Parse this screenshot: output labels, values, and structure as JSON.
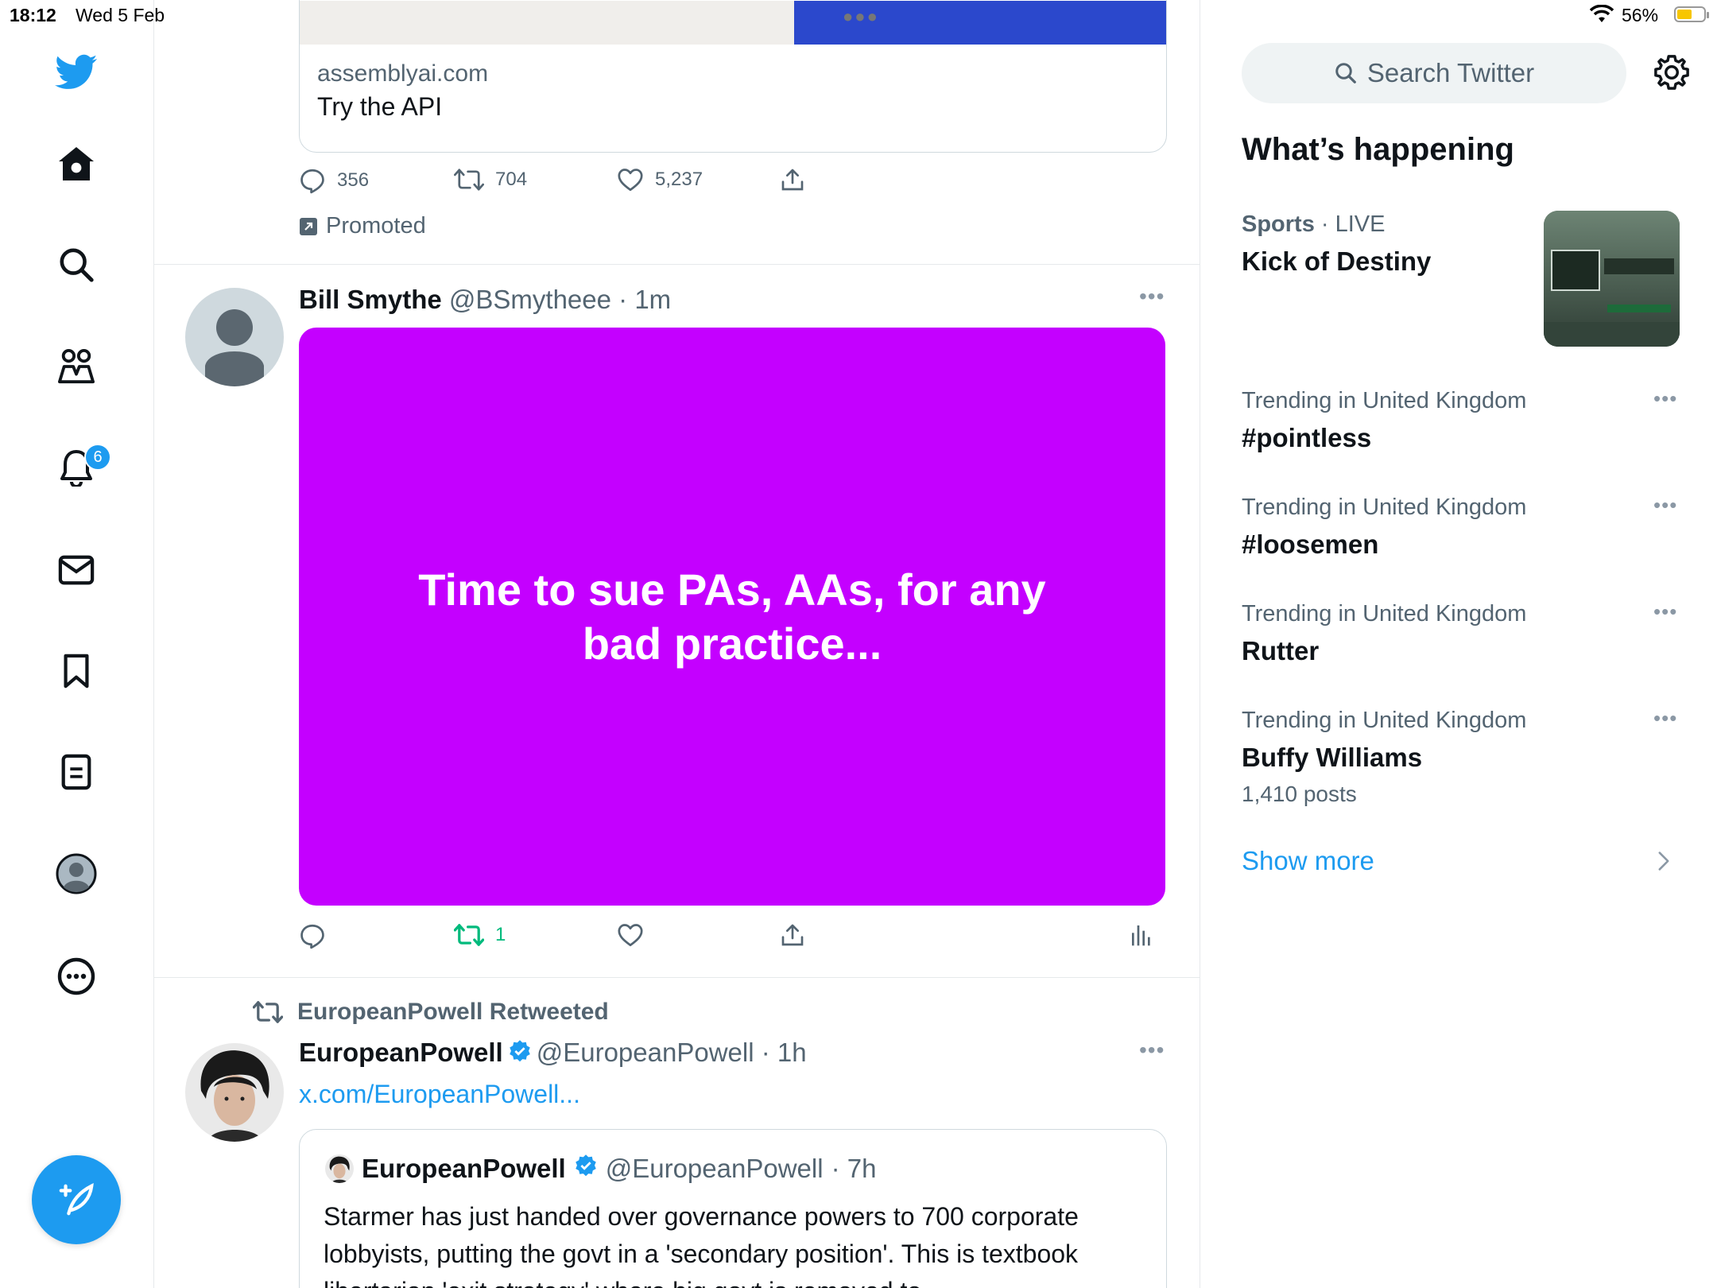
{
  "status_bar": {
    "time": "18:12",
    "date": "Wed 5 Feb",
    "battery": "56%"
  },
  "nav": {
    "notifications_badge": "6"
  },
  "promo_tweet": {
    "card_domain": "assemblyai.com",
    "card_cta": "Try the API",
    "replies": "356",
    "retweets": "704",
    "likes": "5,237",
    "promoted_label": "Promoted"
  },
  "tweet1": {
    "name": "Bill Smythe",
    "handle": "@BSmytheee",
    "time": "· 1m",
    "image_text": "Time to sue PAs, AAs, for any bad practice...",
    "retweets": "1"
  },
  "tweet2": {
    "retweet_label": "EuropeanPowell Retweeted",
    "name": "EuropeanPowell",
    "handle": "@EuropeanPowell",
    "time": "· 1h",
    "link": "x.com/EuropeanPowell...",
    "quote": {
      "name": "EuropeanPowell",
      "handle": "@EuropeanPowell",
      "time": "· 7h",
      "text": "Starmer has just handed over governance powers to 700 corporate lobbyists, putting the govt in a 'secondary position'. This is textbook libertarian 'exit strategy' where big govt is removed to"
    }
  },
  "sidebar": {
    "search_placeholder": "Search Twitter",
    "title": "What’s happening",
    "featured": {
      "category": "Sports",
      "meta": " · LIVE",
      "name": "Kick of Destiny"
    },
    "trends": [
      {
        "meta": "Trending in United Kingdom",
        "name": "#pointless",
        "count": ""
      },
      {
        "meta": "Trending in United Kingdom",
        "name": "#loosemen",
        "count": ""
      },
      {
        "meta": "Trending in United Kingdom",
        "name": "Rutter",
        "count": ""
      },
      {
        "meta": "Trending in United Kingdom",
        "name": "Buffy Williams",
        "count": "1,410 posts"
      }
    ],
    "show_more": "Show more"
  },
  "colors": {
    "accent": "#1d9bf0",
    "promo_image": "#c400ff",
    "retweet_green": "#00ba7c"
  },
  "icons": [
    "twitter-bird-icon",
    "home-icon",
    "search-icon",
    "communities-icon",
    "bell-icon",
    "mail-icon",
    "bookmark-icon",
    "lists-icon",
    "profile-icon",
    "more-circle-icon",
    "compose-icon",
    "reply-icon",
    "retweet-icon",
    "like-icon",
    "share-icon",
    "analytics-icon",
    "verified-icon",
    "gear-icon",
    "chevron-right-icon"
  ]
}
